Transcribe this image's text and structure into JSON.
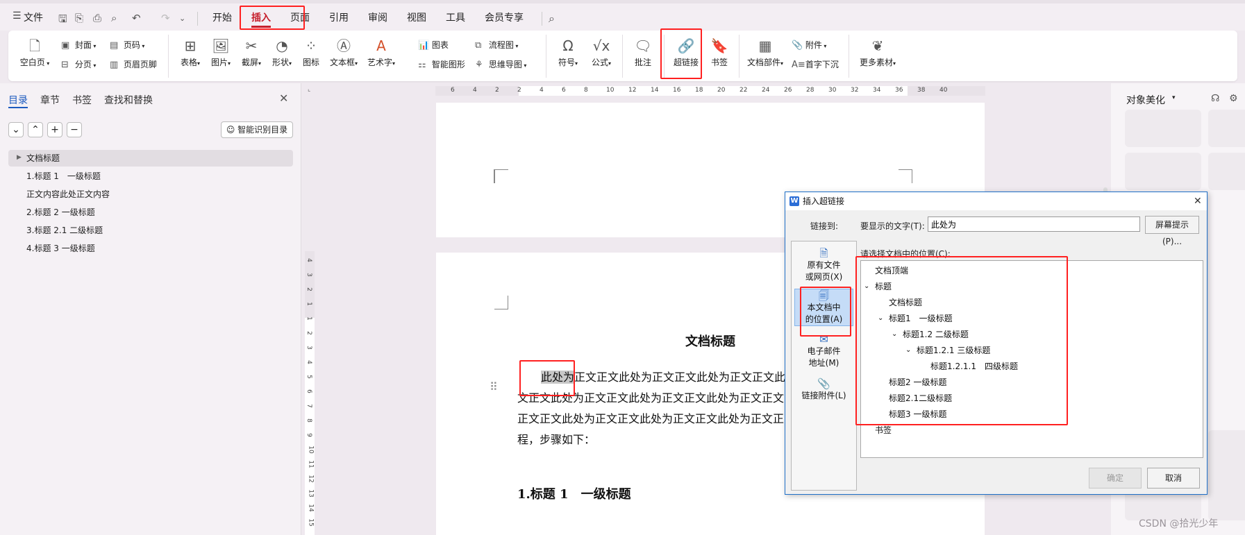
{
  "menubar": {
    "file_label": "文件",
    "tabs": [
      "开始",
      "插入",
      "页面",
      "引用",
      "审阅",
      "视图",
      "工具",
      "会员专享"
    ]
  },
  "ribbon": {
    "blank_page": "空白页",
    "cover": "封面",
    "section_break": "分页",
    "page_number": "页码",
    "header_footer": "页眉页脚",
    "table": "表格",
    "picture": "图片",
    "screenshot": "截屏",
    "shape": "形状",
    "icon": "图标",
    "textbox": "文本框",
    "wordart": "艺术字",
    "chart": "图表",
    "smart_graphic": "智能图形",
    "flowchart": "流程图",
    "mindmap": "思维导图",
    "symbol": "符号",
    "formula": "公式",
    "comment": "批注",
    "hyperlink": "超链接",
    "bookmark": "书签",
    "doc_parts": "文档部件",
    "attachment": "附件",
    "drop_cap": "首字下沉",
    "more_materials": "更多素材"
  },
  "nav": {
    "tabs": [
      "目录",
      "章节",
      "书签",
      "查找和替换"
    ],
    "smart_toc": "智能识别目录",
    "items": [
      "文档标题",
      "1.标题 1　一级标题",
      "正文内容此处正文内容",
      "2.标题 2 一级标题",
      "3.标题 2.1 二级标题",
      "4.标题 3 一级标题"
    ]
  },
  "ruler": {
    "h_ticks": [
      "6",
      "4",
      "2",
      "2",
      "4",
      "6",
      "8",
      "10",
      "12",
      "14",
      "16",
      "18",
      "20",
      "22",
      "24",
      "26",
      "28",
      "30",
      "32",
      "34",
      "36",
      "38",
      "40"
    ],
    "v_ticks": [
      "4",
      "3",
      "2",
      "1",
      "1",
      "2",
      "3",
      "4",
      "5",
      "6",
      "7",
      "8",
      "9",
      "10",
      "11",
      "12",
      "13",
      "14",
      "15"
    ]
  },
  "document": {
    "title": "文档标题",
    "line1_highlight": "此处为",
    "line1_rest": "正文正文此处为正文正文此处为正文正文此",
    "line2": "文正文此处为正文正文此处为正文正文此处为正文正文",
    "line3": "正文正文此处为正文正文此处为正文正文此处为正文正",
    "line4": "程，步骤如下：",
    "heading1": "1.标题 1　一级标题"
  },
  "right_panel": {
    "title": "对象美化"
  },
  "dialog": {
    "title": "插入超链接",
    "link_to": "链接到:",
    "display_text_label": "要显示的文字(T):",
    "display_text_value": "此处为",
    "screen_tip": "屏幕提示(P)...",
    "location_label": "请选择文档中的位置(C):",
    "options": [
      {
        "l1": "原有文件",
        "l2": "或网页(X)"
      },
      {
        "l1": "本文档中",
        "l2": "的位置(A)"
      },
      {
        "l1": "电子邮件",
        "l2": "地址(M)"
      },
      {
        "l1": "链接附件(L)",
        "l2": ""
      }
    ],
    "tree": [
      "文档顶端",
      "标题",
      "文档标题",
      "标题1　一级标题",
      "标题1.2 二级标题",
      "标题1.2.1 三级标题",
      "标题1.2.1.1　四级标题",
      "标题2 一级标题",
      "标题2.1二级标题",
      "标题3 一级标题",
      "书签"
    ],
    "ok": "确定",
    "cancel": "取消"
  },
  "watermark": "CSDN @拾光少年"
}
